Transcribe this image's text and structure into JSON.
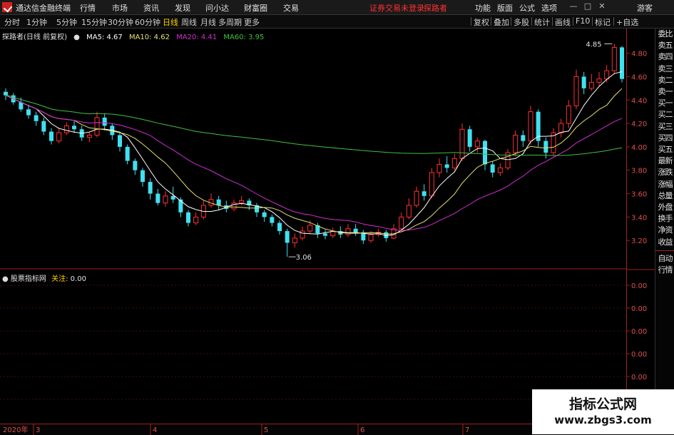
{
  "app": {
    "title": "通达信金融终端",
    "menu": [
      "行情",
      "市场",
      "资讯",
      "发现",
      "问小达",
      "财富圈",
      "交易"
    ],
    "notice": "证券交易未登录",
    "user": "探路者",
    "right_menu": [
      "功能",
      "版面",
      "公式",
      "选项"
    ],
    "window_controls": [
      "minimize-icon",
      "restore-icon",
      "close-icon"
    ],
    "ticker": "游客"
  },
  "toolbar": {
    "periods": [
      "分时",
      "1分钟",
      "5分钟",
      "15分钟",
      "30分钟",
      "60分钟",
      "日线",
      "周线",
      "月线",
      "多周期",
      "更多"
    ],
    "active_period": "日线",
    "buttons": [
      "复权",
      "叠加",
      "多股",
      "统计",
      "画线",
      "F10",
      "标记",
      "+自选"
    ]
  },
  "chart_legend": {
    "stock": "探路者(日线 前复权)",
    "ma": [
      {
        "label": "MA5: 4.67",
        "color": "#ffffff"
      },
      {
        "label": "MA10: 4.62",
        "color": "#e8e070"
      },
      {
        "label": "MA20: 4.41",
        "color": "#d030d0"
      },
      {
        "label": "MA60: 3.95",
        "color": "#40c040"
      }
    ]
  },
  "sub_legend": {
    "name": "股票指标网",
    "field": "关注:",
    "value": "0.00"
  },
  "price_axis": [
    "4.80",
    "4.60",
    "4.40",
    "4.20",
    "4.00",
    "3.80",
    "3.60",
    "3.40",
    "3.20"
  ],
  "sub_axis": [
    "0.00",
    "0.00",
    "0.00",
    "0.00",
    "0.00",
    "0.00"
  ],
  "annotations": {
    "high": "4.85",
    "low": "3.06"
  },
  "side_panel": [
    "委比",
    "卖五",
    "卖四",
    "卖三",
    "卖二",
    "卖一",
    "买一",
    "买二",
    "买三",
    "买四",
    "买五",
    "最新",
    "涨跌",
    "涨幅",
    "总量",
    "外盘",
    "换手",
    "净资",
    "收益"
  ],
  "side_panel_bottom": [
    "自动",
    "行情"
  ],
  "date_axis": [
    "2020年",
    "3",
    "4",
    "5",
    "6",
    "7"
  ],
  "watermark": {
    "title": "指标公式网",
    "url": "www.zbgs3.com"
  },
  "colors": {
    "up": "#ff3030",
    "down": "#40e0f0",
    "grid": "#a02020"
  },
  "chart_data": {
    "type": "candlestick",
    "y_range": [
      3.06,
      4.85
    ],
    "candles": [
      [
        4.47,
        4.44,
        4.5,
        4.4
      ],
      [
        4.44,
        4.38,
        4.46,
        4.36
      ],
      [
        4.38,
        4.32,
        4.42,
        4.3
      ],
      [
        4.32,
        4.27,
        4.36,
        4.24
      ],
      [
        4.27,
        4.22,
        4.3,
        4.18
      ],
      [
        4.22,
        4.13,
        4.25,
        4.1
      ],
      [
        4.13,
        4.05,
        4.16,
        4.02
      ],
      [
        4.05,
        4.12,
        4.16,
        4.03
      ],
      [
        4.12,
        4.18,
        4.21,
        4.1
      ],
      [
        4.18,
        4.15,
        4.22,
        4.12
      ],
      [
        4.15,
        4.08,
        4.18,
        4.05
      ],
      [
        4.08,
        4.1,
        4.13,
        4.04
      ],
      [
        4.1,
        4.25,
        4.3,
        4.08
      ],
      [
        4.25,
        4.18,
        4.28,
        4.14
      ],
      [
        4.18,
        4.1,
        4.2,
        4.06
      ],
      [
        4.1,
        4.0,
        4.12,
        3.96
      ],
      [
        4.0,
        3.88,
        4.02,
        3.85
      ],
      [
        3.88,
        3.8,
        3.9,
        3.76
      ],
      [
        3.8,
        3.7,
        3.82,
        3.66
      ],
      [
        3.7,
        3.6,
        3.73,
        3.55
      ],
      [
        3.6,
        3.52,
        3.64,
        3.5
      ],
      [
        3.52,
        3.58,
        3.62,
        3.49
      ],
      [
        3.58,
        3.55,
        3.66,
        3.52
      ],
      [
        3.55,
        3.44,
        3.57,
        3.4
      ],
      [
        3.44,
        3.35,
        3.46,
        3.32
      ],
      [
        3.35,
        3.4,
        3.44,
        3.33
      ],
      [
        3.4,
        3.5,
        3.54,
        3.38
      ],
      [
        3.5,
        3.55,
        3.6,
        3.48
      ],
      [
        3.55,
        3.5,
        3.58,
        3.46
      ],
      [
        3.5,
        3.47,
        3.54,
        3.44
      ],
      [
        3.47,
        3.52,
        3.55,
        3.45
      ],
      [
        3.52,
        3.54,
        3.58,
        3.5
      ],
      [
        3.54,
        3.5,
        3.56,
        3.46
      ],
      [
        3.5,
        3.44,
        3.52,
        3.4
      ],
      [
        3.44,
        3.4,
        3.46,
        3.36
      ],
      [
        3.4,
        3.35,
        3.42,
        3.32
      ],
      [
        3.35,
        3.28,
        3.37,
        3.25
      ],
      [
        3.28,
        3.18,
        3.3,
        3.06
      ],
      [
        3.18,
        3.22,
        3.26,
        3.14
      ],
      [
        3.22,
        3.28,
        3.32,
        3.2
      ],
      [
        3.28,
        3.33,
        3.37,
        3.26
      ],
      [
        3.33,
        3.26,
        3.35,
        3.22
      ],
      [
        3.26,
        3.24,
        3.29,
        3.21
      ],
      [
        3.24,
        3.28,
        3.31,
        3.22
      ],
      [
        3.28,
        3.25,
        3.32,
        3.22
      ],
      [
        3.25,
        3.3,
        3.34,
        3.23
      ],
      [
        3.3,
        3.27,
        3.34,
        3.24
      ],
      [
        3.27,
        3.2,
        3.29,
        3.17
      ],
      [
        3.2,
        3.25,
        3.28,
        3.18
      ],
      [
        3.25,
        3.27,
        3.3,
        3.23
      ],
      [
        3.27,
        3.22,
        3.29,
        3.19
      ],
      [
        3.22,
        3.3,
        3.34,
        3.21
      ],
      [
        3.3,
        3.4,
        3.44,
        3.28
      ],
      [
        3.4,
        3.5,
        3.56,
        3.38
      ],
      [
        3.5,
        3.62,
        3.66,
        3.48
      ],
      [
        3.62,
        3.58,
        3.68,
        3.54
      ],
      [
        3.58,
        3.78,
        3.82,
        3.56
      ],
      [
        3.78,
        3.85,
        3.9,
        3.74
      ],
      [
        3.85,
        3.82,
        3.92,
        3.78
      ],
      [
        3.82,
        3.9,
        3.94,
        3.8
      ],
      [
        3.9,
        4.15,
        4.2,
        3.88
      ],
      [
        4.15,
        4.0,
        4.18,
        3.96
      ],
      [
        4.0,
        4.05,
        4.08,
        3.95
      ],
      [
        4.05,
        3.85,
        4.06,
        3.8
      ],
      [
        3.85,
        3.78,
        3.88,
        3.74
      ],
      [
        3.78,
        3.82,
        3.86,
        3.75
      ],
      [
        3.82,
        3.95,
        3.98,
        3.8
      ],
      [
        3.95,
        4.1,
        4.14,
        3.92
      ],
      [
        4.1,
        4.05,
        4.14,
        4.0
      ],
      [
        4.05,
        4.3,
        4.35,
        4.02
      ],
      [
        4.3,
        4.05,
        4.32,
        4.0
      ],
      [
        4.05,
        3.95,
        4.08,
        3.9
      ],
      [
        3.95,
        4.12,
        4.16,
        3.93
      ],
      [
        4.12,
        4.2,
        4.24,
        4.08
      ],
      [
        4.2,
        4.35,
        4.4,
        4.16
      ],
      [
        4.35,
        4.6,
        4.66,
        4.32
      ],
      [
        4.6,
        4.5,
        4.64,
        4.45
      ],
      [
        4.5,
        4.55,
        4.62,
        4.48
      ],
      [
        4.55,
        4.58,
        4.64,
        4.52
      ],
      [
        4.58,
        4.65,
        4.7,
        4.55
      ],
      [
        4.65,
        4.85,
        4.88,
        4.62
      ],
      [
        4.85,
        4.58,
        4.86,
        4.55
      ]
    ]
  }
}
